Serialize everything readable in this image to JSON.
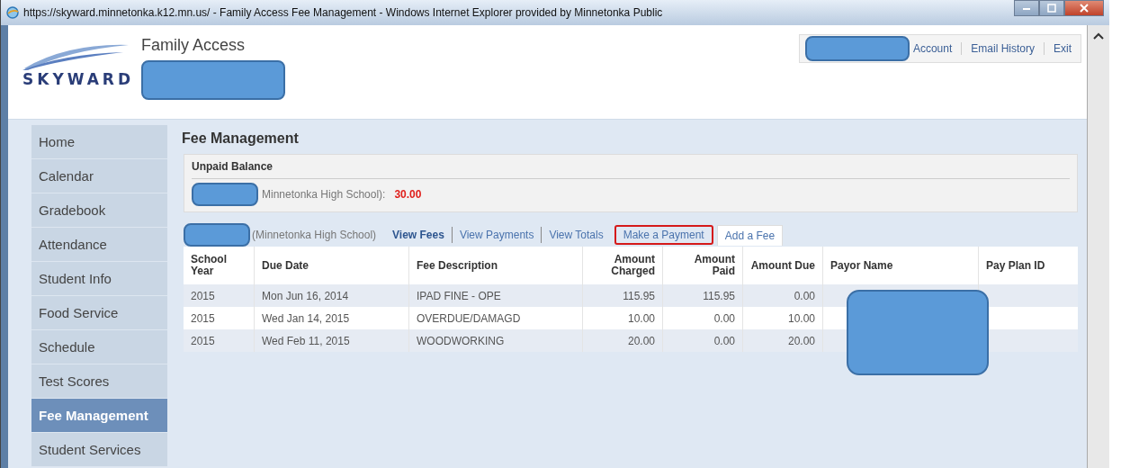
{
  "window": {
    "title": "https://skyward.minnetonka.k12.mn.us/ - Family Access Fee Management - Windows Internet Explorer provided by Minnetonka Public"
  },
  "header": {
    "logo_text": "SKYWARD",
    "app_name": "Family Access",
    "links": [
      {
        "label": "Account"
      },
      {
        "label": "Email History"
      },
      {
        "label": "Exit"
      }
    ]
  },
  "sidebar": {
    "items": [
      {
        "label": "Home",
        "selected": false
      },
      {
        "label": "Calendar",
        "selected": false
      },
      {
        "label": "Gradebook",
        "selected": false
      },
      {
        "label": "Attendance",
        "selected": false
      },
      {
        "label": "Student Info",
        "selected": false
      },
      {
        "label": "Food Service",
        "selected": false
      },
      {
        "label": "Schedule",
        "selected": false
      },
      {
        "label": "Test Scores",
        "selected": false
      },
      {
        "label": "Fee Management",
        "selected": true
      },
      {
        "label": "Student Services",
        "selected": false
      }
    ]
  },
  "page_title": "Fee Management",
  "unpaid_balance": {
    "title": "Unpaid Balance",
    "school": "Minnetonka High School):",
    "amount": "30.00"
  },
  "fees": {
    "school": "(Minnetonka High School)",
    "tabs": [
      {
        "label": "View Fees",
        "selected": true,
        "highlighted": false
      },
      {
        "label": "View Payments",
        "selected": false,
        "highlighted": false
      },
      {
        "label": "View Totals",
        "selected": false,
        "highlighted": false
      },
      {
        "label": "Make a Payment",
        "selected": false,
        "highlighted": true
      },
      {
        "label": "Add a Fee",
        "selected": false,
        "highlighted": false
      }
    ],
    "table": {
      "columns": [
        "School Year",
        "Due Date",
        "Fee Description",
        "Amount Charged",
        "Amount Paid",
        "Amount Due",
        "Payor Name",
        "Pay Plan ID"
      ],
      "rows": [
        [
          "2015",
          "Mon Jun 16, 2014",
          "IPAD FINE - OPE",
          "115.95",
          "115.95",
          "0.00",
          "",
          ""
        ],
        [
          "2015",
          "Wed Jan 14, 2015",
          "OVERDUE/DAMAGD",
          "10.00",
          "0.00",
          "10.00",
          "",
          ""
        ],
        [
          "2015",
          "Wed Feb 11, 2015",
          "WOODWORKING",
          "20.00",
          "0.00",
          "20.00",
          "",
          ""
        ]
      ]
    }
  }
}
